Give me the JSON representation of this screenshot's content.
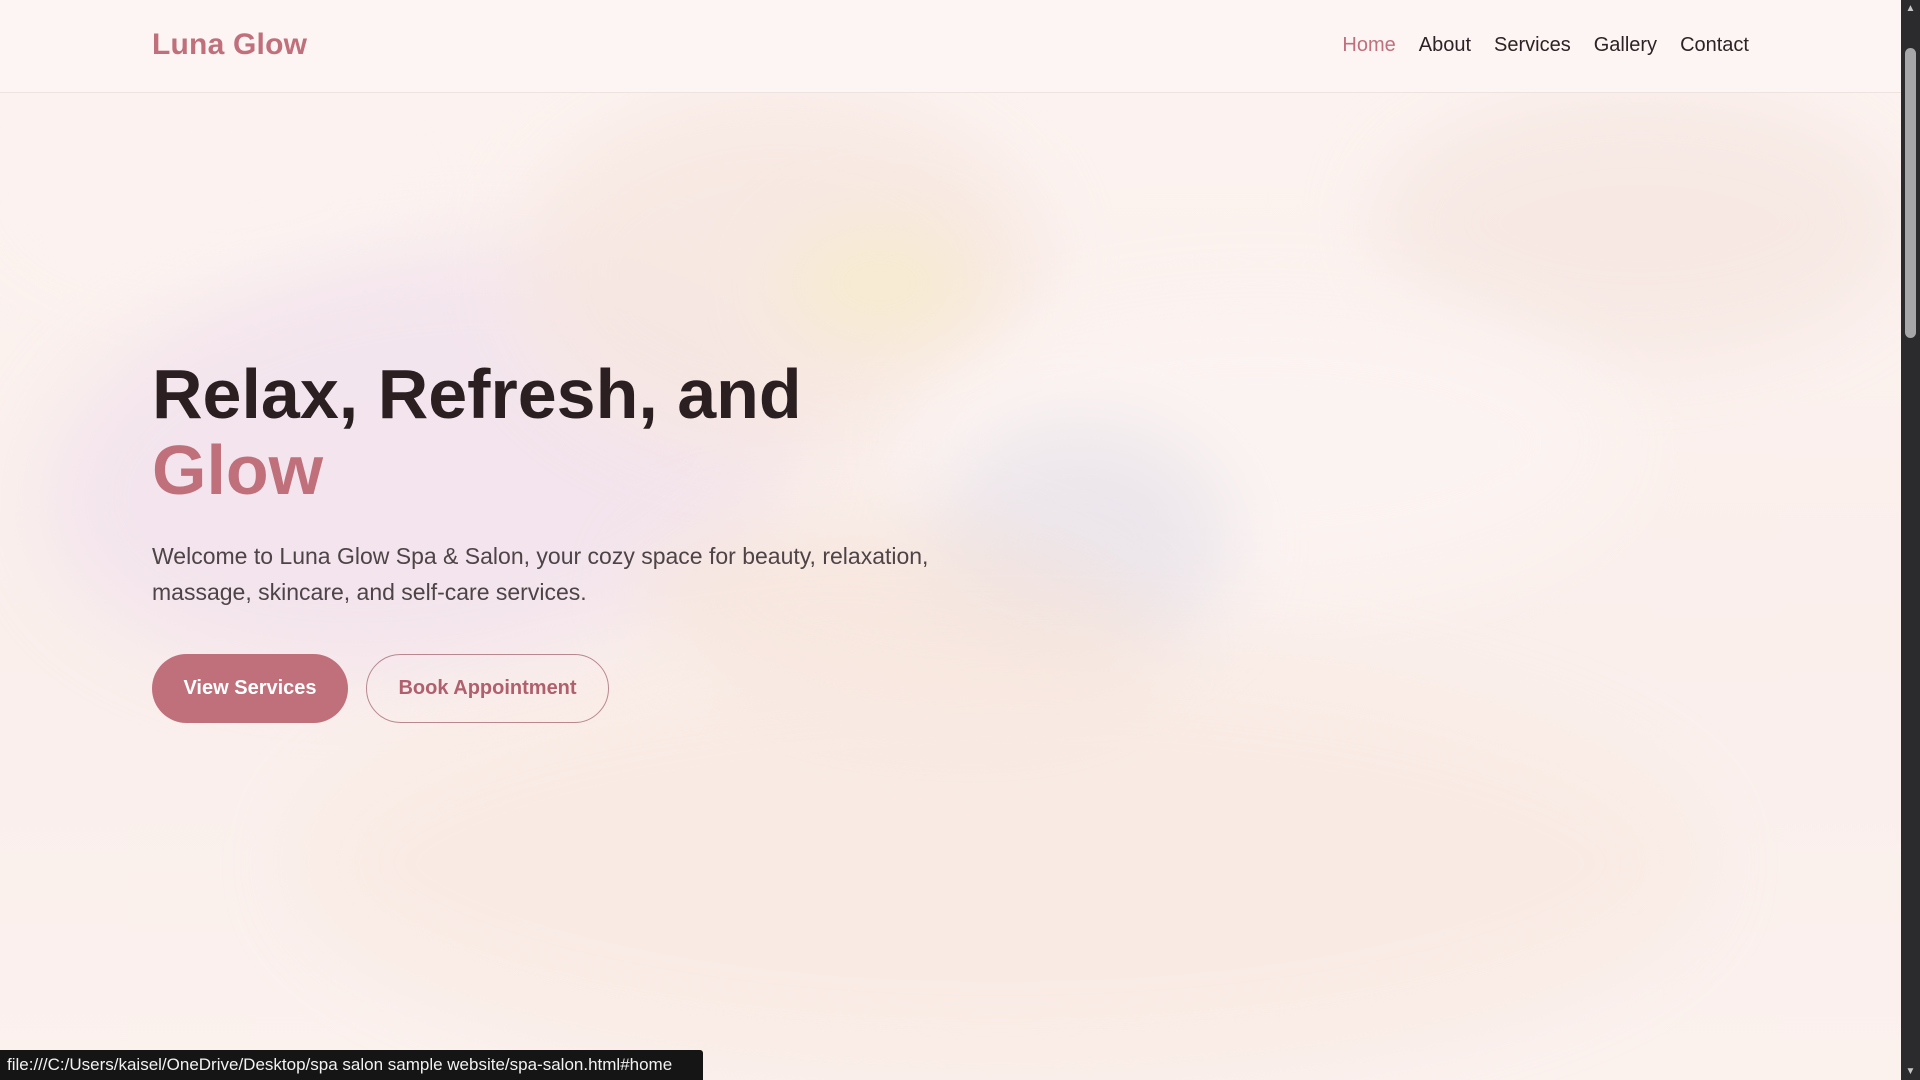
{
  "site": {
    "logo": "Luna Glow"
  },
  "nav": {
    "items": [
      {
        "label": "Home",
        "active": true
      },
      {
        "label": "About",
        "active": false
      },
      {
        "label": "Services",
        "active": false
      },
      {
        "label": "Gallery",
        "active": false
      },
      {
        "label": "Contact",
        "active": false
      }
    ]
  },
  "hero": {
    "title_line1": "Relax, Refresh, and",
    "title_accent": "Glow",
    "description": "Welcome to Luna Glow Spa & Salon, your cozy space for beauty, relaxation, massage, skincare, and self-care services.",
    "primary_button": "View Services",
    "secondary_button": "Book Appointment"
  },
  "status_bar": {
    "url": "file:///C:/Users/kaisel/OneDrive/Desktop/spa salon sample website/spa-salon.html#home"
  },
  "colors": {
    "accent": "#c0707b",
    "text_dark": "#2b1f22",
    "header_bg": "#fdf5f3"
  },
  "icons": {
    "scroll_up": "triangle-up-icon",
    "scroll_down": "triangle-down-icon"
  }
}
